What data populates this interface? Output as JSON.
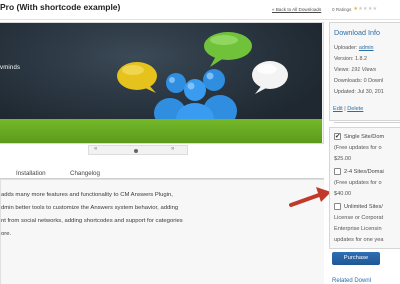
{
  "header": {
    "title": "Pro (With shortcode example)",
    "back_link": "« Back to All Downloads",
    "ratings": "0 Ratings"
  },
  "banner": {
    "brand_prefix": "",
    "brand_suffix": "vminds",
    "colors": {
      "dark": "#2a3641",
      "green": "#6aab22",
      "bubble_green": "#6fc23a",
      "bubble_yellow": "#e6c21d",
      "person_blue": "#2f8ee0"
    }
  },
  "slider": {
    "prev": "«",
    "next": "»"
  },
  "tabs": [
    {
      "label": "Installation"
    },
    {
      "label": "Changelog"
    }
  ],
  "description": [
    "adds many more features and functionality to CM Answers Plugin,",
    "dmin better tools to customize the Answers system behavior, adding",
    "nt from social networks, adding shortcodes and support for categories",
    "ore."
  ],
  "download_info": {
    "title": "Download Info",
    "uploader_label": "Uploader:",
    "uploader": "admin",
    "version": "Version: 1.8.2",
    "views_label": "Views:",
    "views": "191 Views",
    "downloads": "Downloads: 0 Downl",
    "updated": "Updated: Jul 30, 201",
    "edit": "Edit",
    "separator": "|",
    "delete": "Delete"
  },
  "pricing": {
    "options": [
      {
        "label": "Single Site/Dom",
        "lines": [
          "(Free updates for o",
          "$25.00"
        ],
        "checked": true
      },
      {
        "label": "2-4 Sites/Domai",
        "lines": [
          "(Free updates for o",
          "$40.00"
        ],
        "checked": false
      },
      {
        "label": "Unlimited Sites/",
        "lines": [
          "License or Corporat",
          "Enterprise Licensin",
          "updates for one yea"
        ],
        "checked": false
      }
    ],
    "purchase": "Purchase"
  },
  "related_title": "Related Downl"
}
